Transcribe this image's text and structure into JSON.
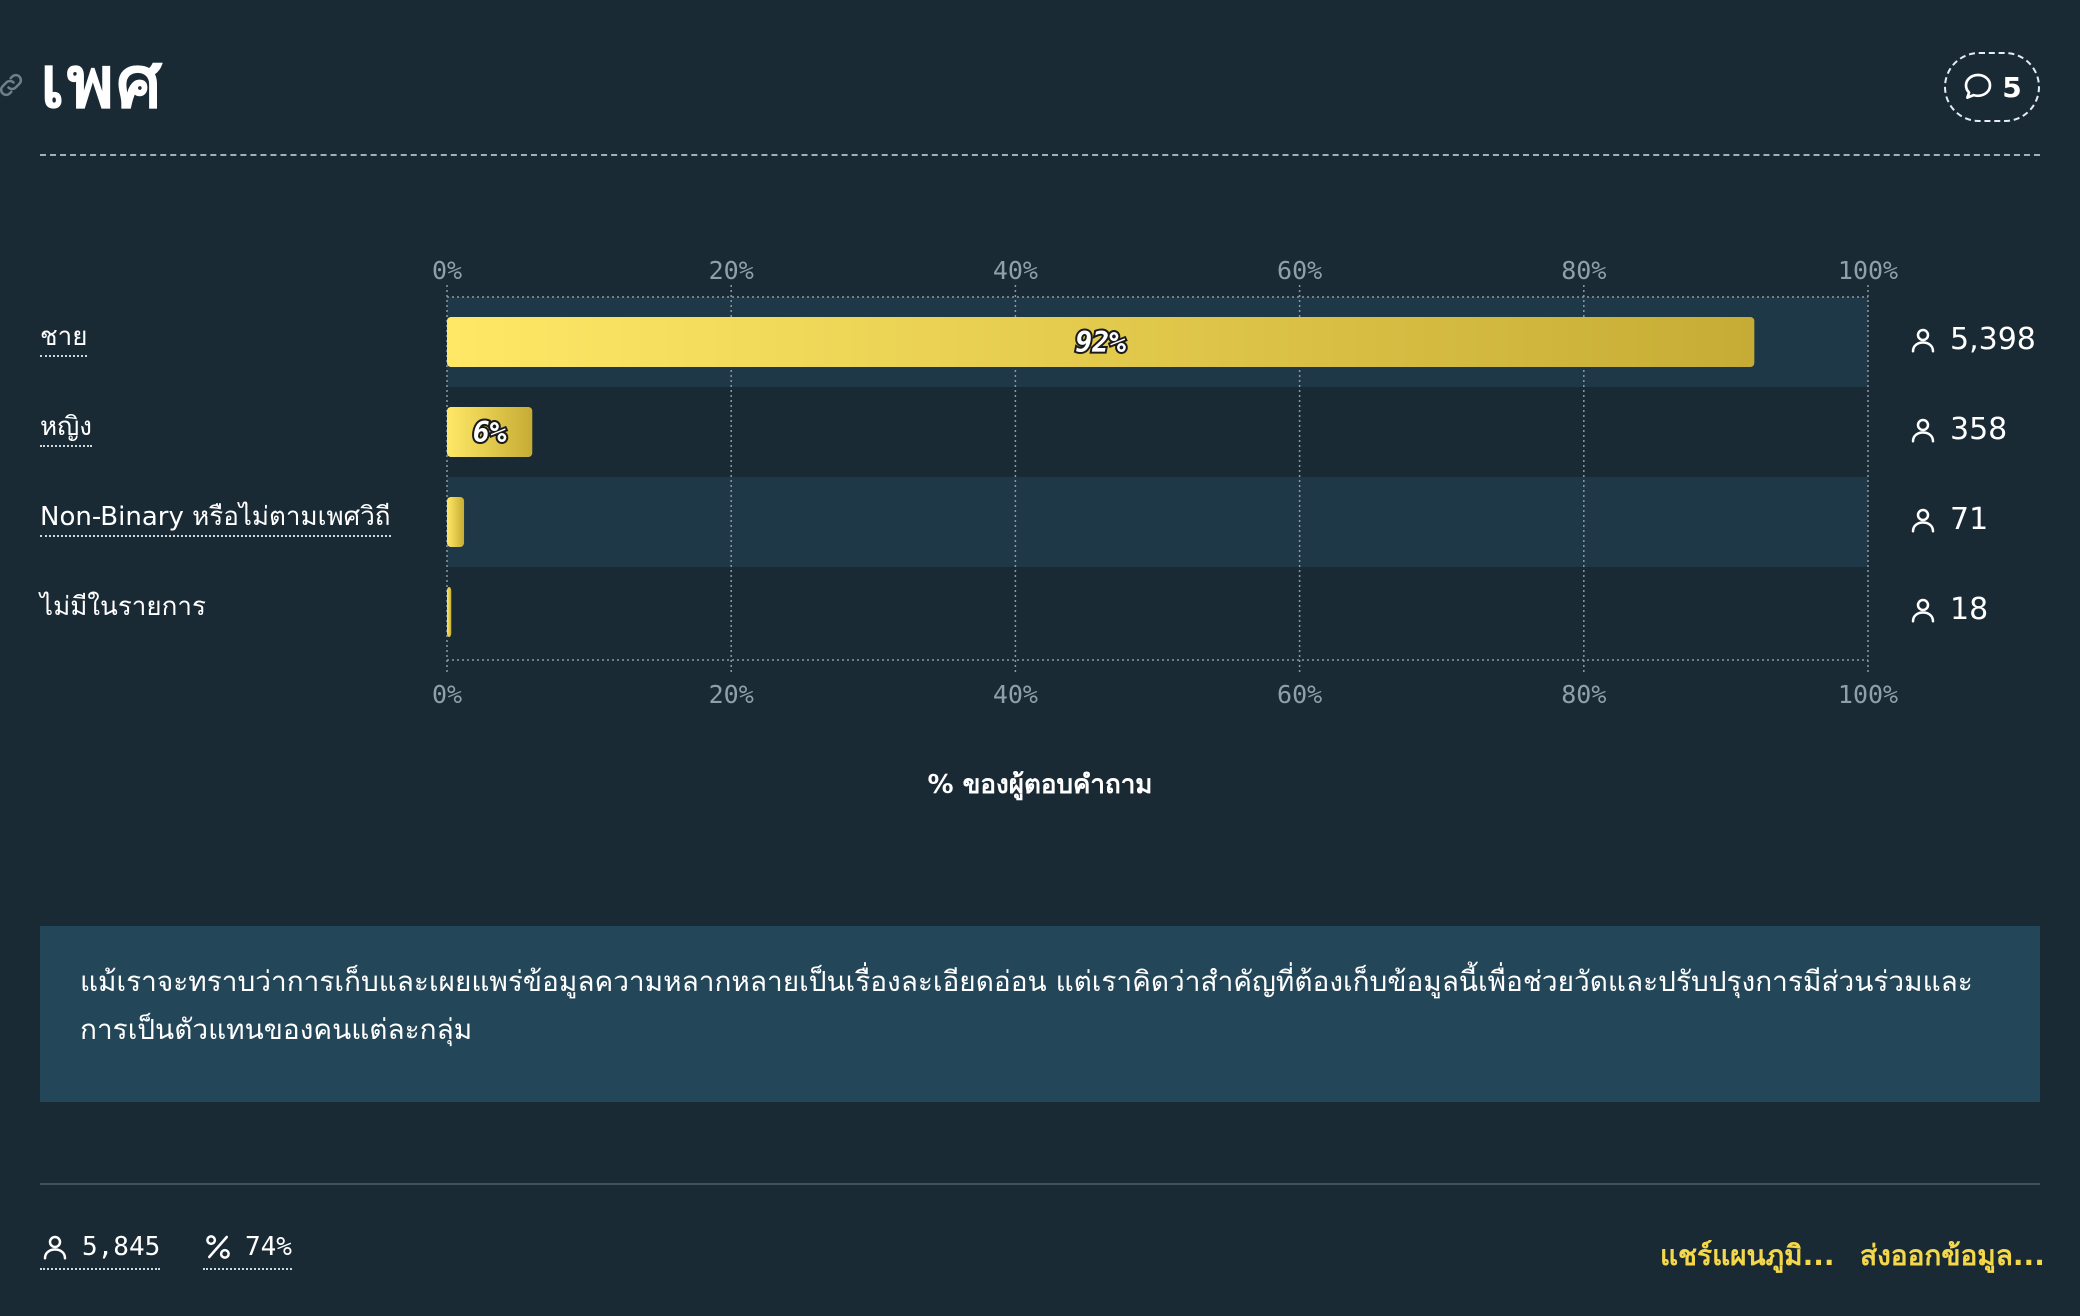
{
  "header": {
    "title": "เพศ",
    "comment_count": "5"
  },
  "chart_data": {
    "type": "bar",
    "orientation": "horizontal",
    "categories": [
      "ชาย",
      "หญิง",
      "Non-Binary หรือไม่ตามเพศวิถี",
      "ไม่มีในรายการ"
    ],
    "values": [
      92,
      6,
      1.2,
      0.3
    ],
    "value_labels": [
      "92%",
      "6%",
      "",
      ""
    ],
    "counts": [
      "5,398",
      "358",
      "71",
      "18"
    ],
    "xlim": [
      0,
      100
    ],
    "xticks": [
      "0%",
      "20%",
      "40%",
      "60%",
      "80%",
      "100%"
    ],
    "xlabel": "% ของผู้ตอบคำถาม",
    "bar_color_start": "#ffe866",
    "bar_color_end": "#c6ac34"
  },
  "note": {
    "text": "แม้เราจะทราบว่าการเก็บและเผยแพร่ข้อมูลความหลากหลายเป็นเรื่องละเอียดอ่อน แต่เราคิดว่าสำคัญที่ต้องเก็บข้อมูลนี้เพื่อช่วยวัดและปรับปรุงการมีส่วนร่วมและการเป็นตัวแทนของคนแต่ละกลุ่ม"
  },
  "footer": {
    "respondents": "5,845",
    "percent": "74%",
    "share_label": "แชร์แผนภูมิ...",
    "export_label": "ส่งออกข้อมูล..."
  }
}
